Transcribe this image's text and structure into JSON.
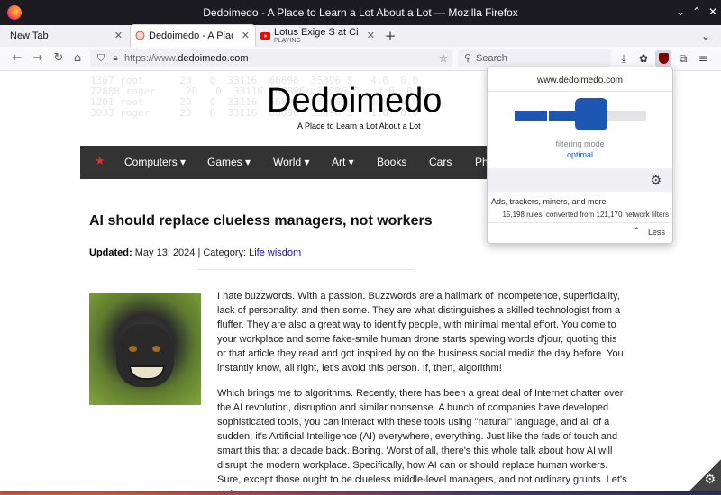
{
  "window": {
    "title": "Dedoimedo - A Place to Learn a Lot About a Lot — Mozilla Firefox"
  },
  "tabs": [
    {
      "label": "New Tab"
    },
    {
      "label": "Dedoimedo - A Place to Lea"
    },
    {
      "label": "Lotus Exige S at Circuit de",
      "sub": "PLAYING"
    }
  ],
  "navbar": {
    "url_prefix": "https://www.",
    "url_domain": "dedoimedo.com",
    "search_placeholder": "Search"
  },
  "site": {
    "title": "Dedoimedo",
    "tagline": "A Place to Learn a Lot About a Lot",
    "menu": [
      "Computers ▾",
      "Games ▾",
      "World ▾",
      "Art ▾",
      "Books",
      "Cars",
      "Ph"
    ],
    "bg_ascii": [
      "1367 root      20   0  33116  66896  35396 S   4.0  0.0",
      "72808 roger     20   0  33116  66896  35396 S   4.0  0.0",
      "1201 root      20   0  33116  66896  35396 S   1.0  0.0",
      "3033 roger     20   0  33116  66896  35396 S   1.0  0.0"
    ]
  },
  "article": {
    "title": "AI should replace clueless managers, not workers",
    "updated_label": "Updated:",
    "updated_date": "May 13, 2024 | Category:",
    "category": "Life wisdom",
    "para1": "I hate buzzwords. With a passion. Buzzwords are a hallmark of incompetence, superficiality, lack of personality, and then some. They are what distinguishes a skilled technologist from a fluffer. They are also a great way to identify people, with minimal mental effort. You come to your workplace and some fake-smile human drone starts spewing words d'jour, quoting this or that article they read and got inspired by on the business social media the day before. You instantly know, all right, let's avoid this person. If, then, algorithm!",
    "para2": "Which brings me to algorithms. Recently, there has been a great deal of Internet chatter over the AI revolution, disruption and similar nonsense. A bunch of companies have developed sophisticated tools, you can interact with these tools using \"natural\" language, and all of a sudden, it's Artificial Intelligence (AI) everywhere, everything. Just like the fads of touch and smart this that a decade back. Boring. Worst of all, there's this whole talk about how AI will disrupt the modern workplace. Specifically, how AI can or should replace human workers. Sure, except those ought to be clueless middle-level managers, and not ordinary grunts. Let's elaborate."
  },
  "popup": {
    "domain": "www.dedoimedo.com",
    "filtering_label": "filtering mode",
    "filtering_value": "optimal",
    "filtering_level": 0.5,
    "stat1": "Ads, trackers, miners, and more",
    "stat2": "15,198 rules, converted from 121,170 network filters",
    "less_label": "Less"
  },
  "colors": {
    "accent": "#1d57b3",
    "menu_bg": "#333333",
    "titlebar_bg": "#1c1b22"
  }
}
